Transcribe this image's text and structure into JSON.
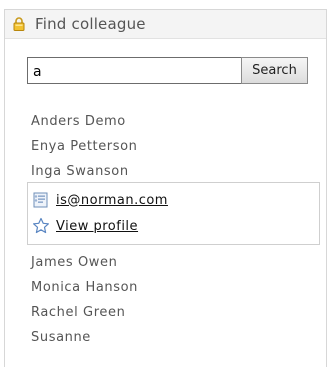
{
  "widget": {
    "title": "Find colleague",
    "icon": "lock-icon"
  },
  "search": {
    "value": "a",
    "button_label": "Search"
  },
  "results": [
    "Anders Demo",
    "Enya Petterson",
    "Inga Swanson",
    "James Owen",
    "Monica Hanson",
    "Rachel Green",
    "Susanne"
  ],
  "popup": {
    "email": "is@norman.com",
    "email_icon": "contact-card-icon",
    "profile_label": "View profile",
    "profile_icon": "star-icon"
  },
  "colors": {
    "header_bg": "#f4f4f4",
    "border": "#d7d7d7",
    "text": "#555555"
  }
}
